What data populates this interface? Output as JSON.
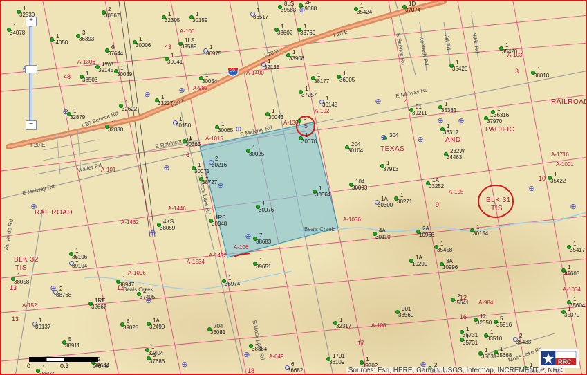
{
  "map": {
    "scale": {
      "label_0": "0",
      "label_mid": "0.3",
      "label_end": "0.6mi"
    },
    "attribution": "Sources: Esri, HERE, Garmin, USGS, Intermap, INCREMENT P, NRC",
    "zoom": {
      "plus": "+",
      "minus": "−"
    },
    "logo_text": "RRC",
    "colors": {
      "highway": "#e08a5c",
      "survey_line": "#d3266f",
      "lease_fill": "#7cc4d8",
      "well": "#1ea31e",
      "marker": "#d21b1b",
      "creek": "#9ad0e8"
    },
    "survey_labels": {
      "railroad_1": "RAILROAD",
      "railroad_2": "RAILROAD",
      "railroad_3": "RAILROAD",
      "texas": "TEXAS",
      "and": "AND",
      "pacific": "PACIFIC",
      "blk31_a": "BLK 31",
      "blk31_b": "TIS",
      "blk32_a": "BLK 32",
      "blk32_b": "TIS"
    },
    "roads": {
      "i20e_a": "I-20 E",
      "i20w": "I-20 W",
      "i20e_b": "I-20 E",
      "i20e_c": "I-20 E",
      "i20_shield": "20",
      "midway_1": "E Midway Rd",
      "midway_2": "E Midway Rd",
      "midway_3": "E Midway Rd",
      "robinson": "E Robinson Rd",
      "walter": "Walter Rd",
      "valverde": "Val Verde Rd",
      "smoss": "S Moss Lake Rd",
      "smoss2": "S Moss Lake Rd",
      "kenneth": "Kenneth Rd",
      "jill": "Jill Rd",
      "vikki": "Vikki Rd",
      "sservice": "S Service Rd",
      "beals_1": "Beals Creek",
      "beals_2": "Beals Creek",
      "mosslake": "Moss Lake Rd",
      "service_rd": "I-20 Service Rd"
    },
    "abstracts": {
      "a1306": "A-1306",
      "a100": "A-100",
      "a1400": "A-1400",
      "a982": "A-982",
      "a1307": "A-1307",
      "a102": "A-102",
      "a1015": "A-1015",
      "a101": "A-101",
      "a1446": "A-1446",
      "a1462": "A-1462",
      "a106": "A-106",
      "a1036": "A-1036",
      "a105": "A-105",
      "a1716": "A-1716",
      "a1001": "A-1001",
      "a103": "A-103",
      "a1534": "A-1534",
      "a1452": "A-1452",
      "a1006": "A-1006",
      "a152": "A-152",
      "a108": "A-108",
      "a984": "A-984",
      "a649": "A-649",
      "a1034": "A-1034"
    },
    "section_numbers": {
      "s48": "48",
      "s43": "43",
      "s6": "6",
      "s5": "5",
      "s4": "4",
      "s3": "3",
      "s9": "9",
      "s10": "10",
      "s11": "11",
      "s12": "12",
      "s13": "13",
      "s16": "16",
      "s17": "17",
      "s18": "18",
      "s15": "15",
      "s14": "14"
    },
    "wells": [
      {
        "id": "1",
        "api": "32539"
      },
      {
        "id": "2",
        "api": "30567"
      },
      {
        "id": "1",
        "api": "32305"
      },
      {
        "id": "1",
        "api": "30159"
      },
      {
        "id": "1",
        "api": "36517"
      },
      {
        "id": "8LS",
        "api": "39583"
      },
      {
        "id": "2F",
        "api": "39688"
      },
      {
        "id": "1",
        "api": "35424"
      },
      {
        "id": "1D",
        "api": "37074"
      },
      {
        "id": "1",
        "api": "34050"
      },
      {
        "id": "3",
        "api": "36393"
      },
      {
        "id": "1",
        "api": "30006"
      },
      {
        "id": "1LS",
        "api": "39589"
      },
      {
        "id": "1",
        "api": "36975"
      },
      {
        "id": "1",
        "api": "33602"
      },
      {
        "id": "1",
        "api": "33769"
      },
      {
        "id": "6",
        "api": "37644"
      },
      {
        "id": "1",
        "api": "30041"
      },
      {
        "id": "1",
        "api": "33908"
      },
      {
        "id": "1",
        "api": "35420"
      },
      {
        "id": "1WA",
        "api": "39145"
      },
      {
        "id": "1",
        "api": "30059"
      },
      {
        "id": "1",
        "api": "32138"
      },
      {
        "id": "1",
        "api": "35426"
      },
      {
        "id": "1",
        "api": "38503"
      },
      {
        "id": "1",
        "api": "30054"
      },
      {
        "id": "1",
        "api": "38177"
      },
      {
        "id": "1",
        "api": "36005"
      },
      {
        "id": "1",
        "api": "38010"
      },
      {
        "id": "1",
        "api": "33227"
      },
      {
        "id": "1",
        "api": "37257"
      },
      {
        "id": "1",
        "api": "30148"
      },
      {
        "id": "1",
        "api": "32622"
      },
      {
        "id": "1",
        "api": "32879"
      },
      {
        "id": "1",
        "api": "32880"
      },
      {
        "id": "1",
        "api": "30043"
      },
      {
        "id": "01",
        "api": "39211"
      },
      {
        "id": "1",
        "api": "35381"
      },
      {
        "id": "1",
        "api": "36316"
      },
      {
        "id": "1",
        "api": "37970"
      },
      {
        "id": "1",
        "api": "30150"
      },
      {
        "id": "1",
        "api": "30065"
      },
      {
        "id": "1",
        "api": "30365"
      },
      {
        "id": "1",
        "api": "30070"
      },
      {
        "id": "1",
        "api": "36312"
      },
      {
        "id": "1",
        "api": "30025"
      },
      {
        "id": "204",
        "api": "30104"
      },
      {
        "id": "304",
        "api": ""
      },
      {
        "id": "232W",
        "api": "34463"
      },
      {
        "id": "2",
        "api": "30216"
      },
      {
        "id": "1",
        "api": "30071"
      },
      {
        "id": "1",
        "api": "37913"
      },
      {
        "id": "1",
        "api": "38727"
      },
      {
        "id": "1",
        "api": "30064"
      },
      {
        "id": "104",
        "api": "30093"
      },
      {
        "id": "1A",
        "api": "03252"
      },
      {
        "id": "1",
        "api": "35422"
      },
      {
        "id": "1",
        "api": "30076"
      },
      {
        "id": "1A",
        "api": "30300"
      },
      {
        "id": "1",
        "api": "30271"
      },
      {
        "id": "4KS",
        "api": "38059"
      },
      {
        "id": "1RB",
        "api": "30048"
      },
      {
        "id": "7",
        "api": "38683"
      },
      {
        "id": "4A",
        "api": "30110"
      },
      {
        "id": "2A",
        "api": "10966"
      },
      {
        "id": "1",
        "api": "30154"
      },
      {
        "id": "1",
        "api": "36196"
      },
      {
        "id": "1",
        "api": "39194"
      },
      {
        "id": "1",
        "api": "35458"
      },
      {
        "id": "1A",
        "api": "10299"
      },
      {
        "id": "3A",
        "api": "10996"
      },
      {
        "id": "1",
        "api": "35417"
      },
      {
        "id": "1",
        "api": "38058"
      },
      {
        "id": "1",
        "api": "36974"
      },
      {
        "id": "1",
        "api": "39651"
      },
      {
        "id": "1",
        "api": "35603"
      },
      {
        "id": "2",
        "api": "38768"
      },
      {
        "id": "1",
        "api": "38947"
      },
      {
        "id": "2",
        "api": "37405"
      },
      {
        "id": "1RE",
        "api": "32667"
      },
      {
        "id": "2",
        "api": "35641"
      },
      {
        "id": "1",
        "api": "35604"
      },
      {
        "id": "1",
        "api": "35370"
      },
      {
        "id": "901",
        "api": "33560"
      },
      {
        "id": "1",
        "api": "32317"
      },
      {
        "id": "1",
        "api": "39137"
      },
      {
        "id": "6",
        "api": "39028"
      },
      {
        "id": "1A",
        "api": "32490"
      },
      {
        "id": "704",
        "api": "36081"
      },
      {
        "id": "12",
        "api": "32350"
      },
      {
        "id": "5",
        "api": "35916"
      },
      {
        "id": "1",
        "api": "35731"
      },
      {
        "id": "1",
        "api": "35731"
      },
      {
        "id": "1",
        "api": "33510"
      },
      {
        "id": "2",
        "api": "35433"
      },
      {
        "id": "5",
        "api": "38911"
      },
      {
        "id": "1",
        "api": "32404"
      },
      {
        "id": "3",
        "api": "37686"
      },
      {
        "id": "1",
        "api": "38364"
      },
      {
        "id": "1",
        "api": "35668"
      },
      {
        "id": "1",
        "api": "35631"
      },
      {
        "id": "2",
        "api": "38644"
      },
      {
        "id": "1",
        "api": "38603"
      },
      {
        "id": "6",
        "api": "36682"
      },
      {
        "id": "1701",
        "api": "36109"
      },
      {
        "id": "1",
        "api": "39702"
      },
      {
        "id": "2",
        "api": "35577"
      },
      {
        "id": "1",
        "api": "35667"
      },
      {
        "id": "1",
        "api": "34078"
      },
      {
        "id": "5",
        "api": ""
      }
    ]
  }
}
